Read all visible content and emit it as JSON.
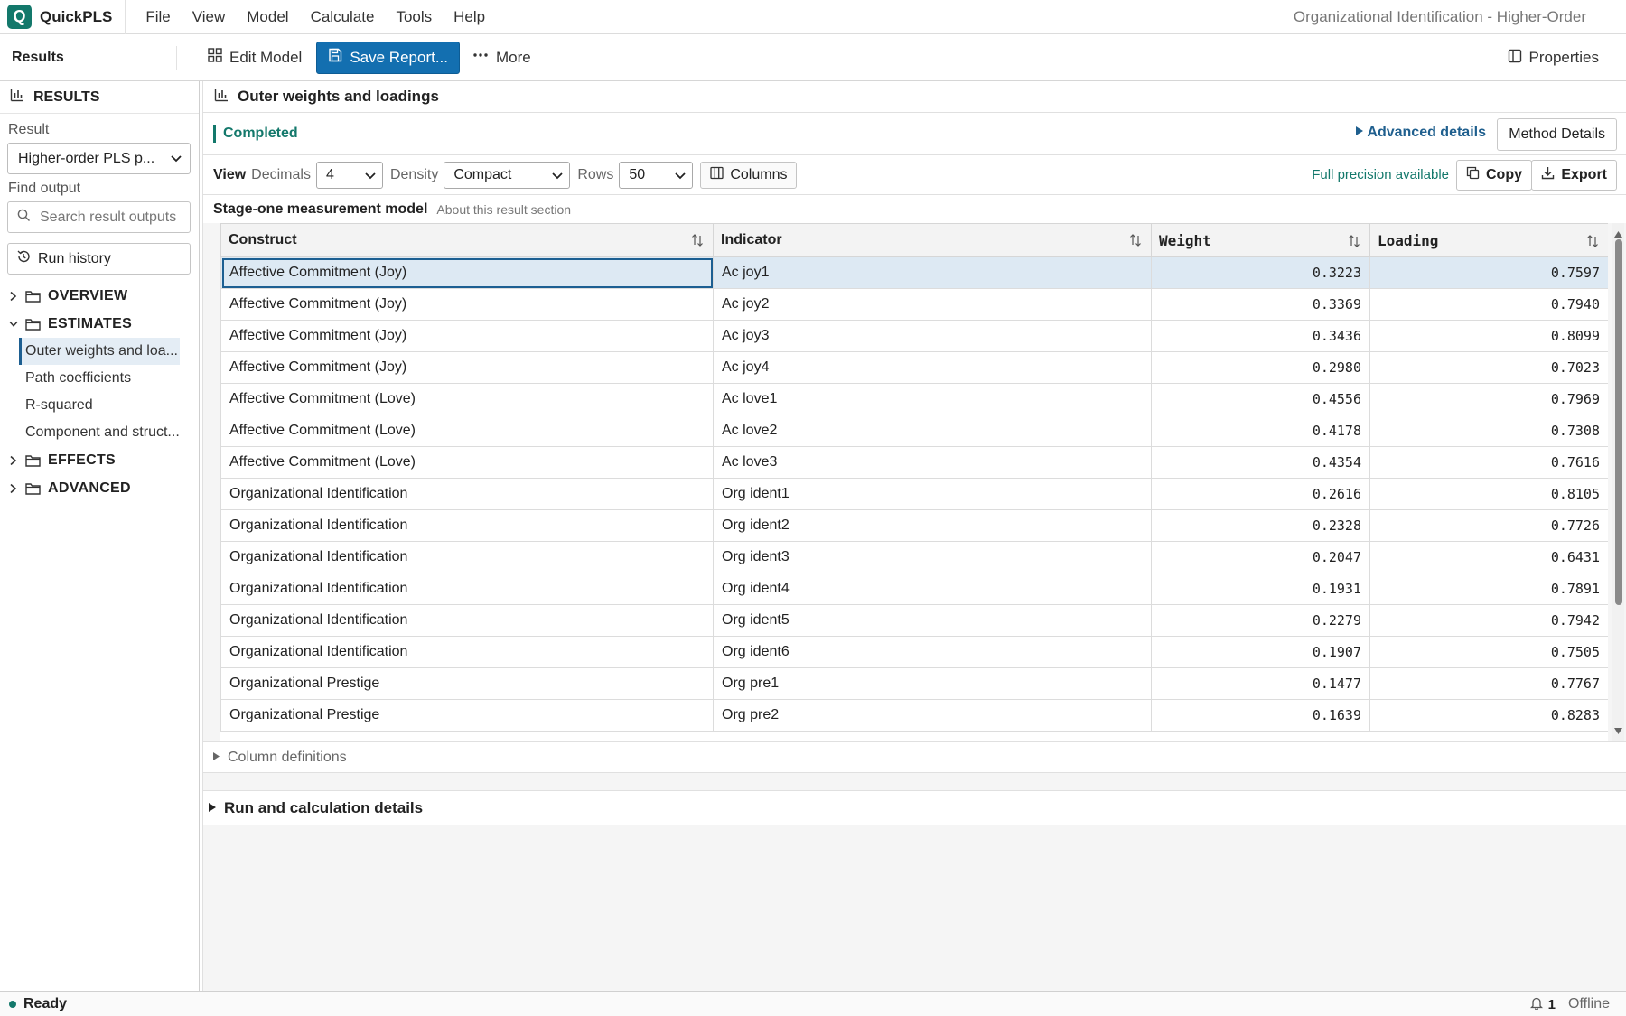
{
  "app": {
    "logo_letter": "Q",
    "name": "QuickPLS",
    "window_title": "Organizational Identification - Higher-Order",
    "menu": [
      "File",
      "View",
      "Model",
      "Calculate",
      "Tools",
      "Help"
    ],
    "accent_color": "#13786b",
    "primary_color": "#136fb0"
  },
  "toolbar": {
    "title": "Results",
    "edit_model": "Edit Model",
    "save_report": "Save Report...",
    "more": "More",
    "properties": "Properties"
  },
  "sidebar": {
    "title": "RESULTS",
    "result_label": "Result",
    "result_value": "Higher-order PLS p...",
    "find_label": "Find output",
    "search_placeholder": "Search result outputs",
    "run_history": "Run history",
    "tree": [
      {
        "label": "OVERVIEW",
        "expanded": false,
        "children": []
      },
      {
        "label": "ESTIMATES",
        "expanded": true,
        "children": [
          {
            "label": "Outer weights and loa...",
            "active": true
          },
          {
            "label": "Path coefficients",
            "active": false
          },
          {
            "label": "R-squared",
            "active": false
          },
          {
            "label": "Component and struct...",
            "active": false
          }
        ]
      },
      {
        "label": "EFFECTS",
        "expanded": false,
        "children": []
      },
      {
        "label": "ADVANCED",
        "expanded": false,
        "children": []
      }
    ]
  },
  "main": {
    "section_title": "Outer weights and loadings",
    "status": "Completed",
    "advanced_details": "Advanced details",
    "method_details": "Method Details",
    "view": {
      "label": "View",
      "decimals_label": "Decimals",
      "decimals_value": "4",
      "density_label": "Density",
      "density_value": "Compact",
      "rows_label": "Rows",
      "rows_value": "50",
      "columns_button": "Columns",
      "full_precision": "Full precision available",
      "copy": "Copy",
      "export": "Export"
    },
    "subsection_title": "Stage-one measurement model",
    "subsection_about": "About this result section",
    "table": {
      "columns": [
        "Construct",
        "Indicator",
        "Weight",
        "Loading"
      ],
      "rows": [
        [
          "Affective Commitment (Joy)",
          "Ac joy1",
          "0.3223",
          "0.7597"
        ],
        [
          "Affective Commitment (Joy)",
          "Ac joy2",
          "0.3369",
          "0.7940"
        ],
        [
          "Affective Commitment (Joy)",
          "Ac joy3",
          "0.3436",
          "0.8099"
        ],
        [
          "Affective Commitment (Joy)",
          "Ac joy4",
          "0.2980",
          "0.7023"
        ],
        [
          "Affective Commitment (Love)",
          "Ac love1",
          "0.4556",
          "0.7969"
        ],
        [
          "Affective Commitment (Love)",
          "Ac love2",
          "0.4178",
          "0.7308"
        ],
        [
          "Affective Commitment (Love)",
          "Ac love3",
          "0.4354",
          "0.7616"
        ],
        [
          "Organizational Identification",
          "Org ident1",
          "0.2616",
          "0.8105"
        ],
        [
          "Organizational Identification",
          "Org ident2",
          "0.2328",
          "0.7726"
        ],
        [
          "Organizational Identification",
          "Org ident3",
          "0.2047",
          "0.6431"
        ],
        [
          "Organizational Identification",
          "Org ident4",
          "0.1931",
          "0.7891"
        ],
        [
          "Organizational Identification",
          "Org ident5",
          "0.2279",
          "0.7942"
        ],
        [
          "Organizational Identification",
          "Org ident6",
          "0.1907",
          "0.7505"
        ],
        [
          "Organizational Prestige",
          "Org pre1",
          "0.1477",
          "0.7767"
        ],
        [
          "Organizational Prestige",
          "Org pre2",
          "0.1639",
          "0.8283"
        ]
      ]
    },
    "column_definitions": "Column definitions",
    "run_details": "Run and calculation details"
  },
  "statusbar": {
    "ready": "Ready",
    "notifications": "1",
    "connection": "Offline"
  }
}
